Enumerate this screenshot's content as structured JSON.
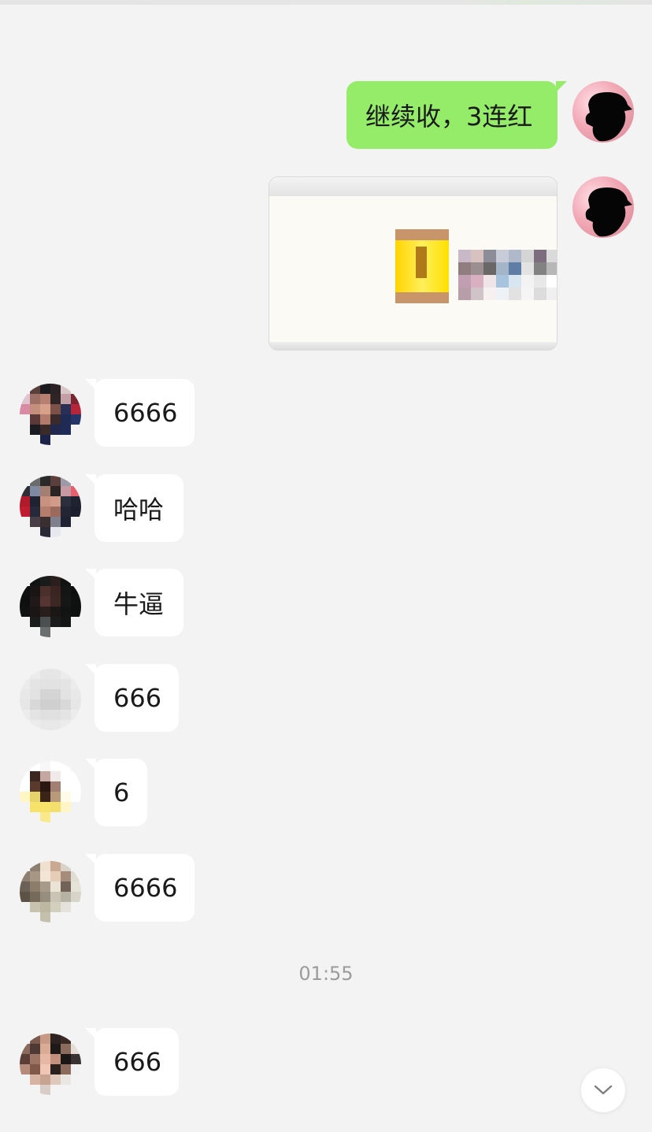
{
  "messages_out": [
    {
      "text": "继续收，3连红"
    }
  ],
  "messages_in": [
    {
      "text": "6666"
    },
    {
      "text": "哈哈"
    },
    {
      "text": "牛逼"
    },
    {
      "text": "666"
    },
    {
      "text": "6"
    },
    {
      "text": "6666"
    },
    {
      "text": "666"
    }
  ],
  "timestamp": "01:55",
  "icons": {
    "scroll_down": "chevron-down-icon"
  },
  "colors": {
    "background": "#f3f3f3",
    "outgoing_bubble": "#95ec69",
    "incoming_bubble": "#ffffff",
    "timestamp_text": "#9b9b9b"
  }
}
